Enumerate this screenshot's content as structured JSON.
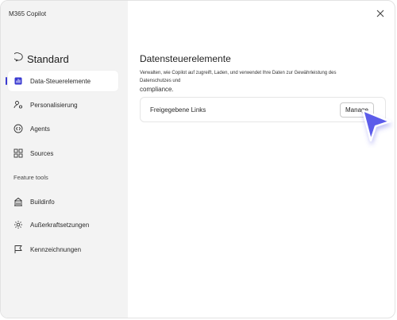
{
  "app": {
    "title": "M365 Copilot"
  },
  "sidebar": {
    "standard_label": "Standard",
    "items": [
      {
        "label": "Data-Steuerelemente",
        "icon": "bar-chart-icon",
        "active": true
      },
      {
        "label": "Personalisierung",
        "icon": "person-settings-icon"
      },
      {
        "label": "Agents",
        "icon": "code-agent-icon"
      },
      {
        "label": "Sources",
        "icon": "apps-grid-icon"
      }
    ],
    "section_label": "Feature tools",
    "tools": [
      {
        "label": "Buildinfo",
        "icon": "building-icon"
      },
      {
        "label": "Außerkraftsetzungen",
        "icon": "gear-icon"
      },
      {
        "label": "Kennzeichnungen",
        "icon": "flag-icon"
      }
    ]
  },
  "main": {
    "title": "Datensteuerelemente",
    "description_line1": "Verwalten, wie Copilot auf zugreift, Laden, und verwendet Ihre Daten zur Gewährleistung des Datenschutzes und",
    "description_line2": "compliance.",
    "card": {
      "label": "Freigegebene Links",
      "button_label": "Manage"
    }
  },
  "colors": {
    "sidebar_bg": "#f3f3f3",
    "accent": "#3a3ad0",
    "cursor": "#5b5bea"
  }
}
